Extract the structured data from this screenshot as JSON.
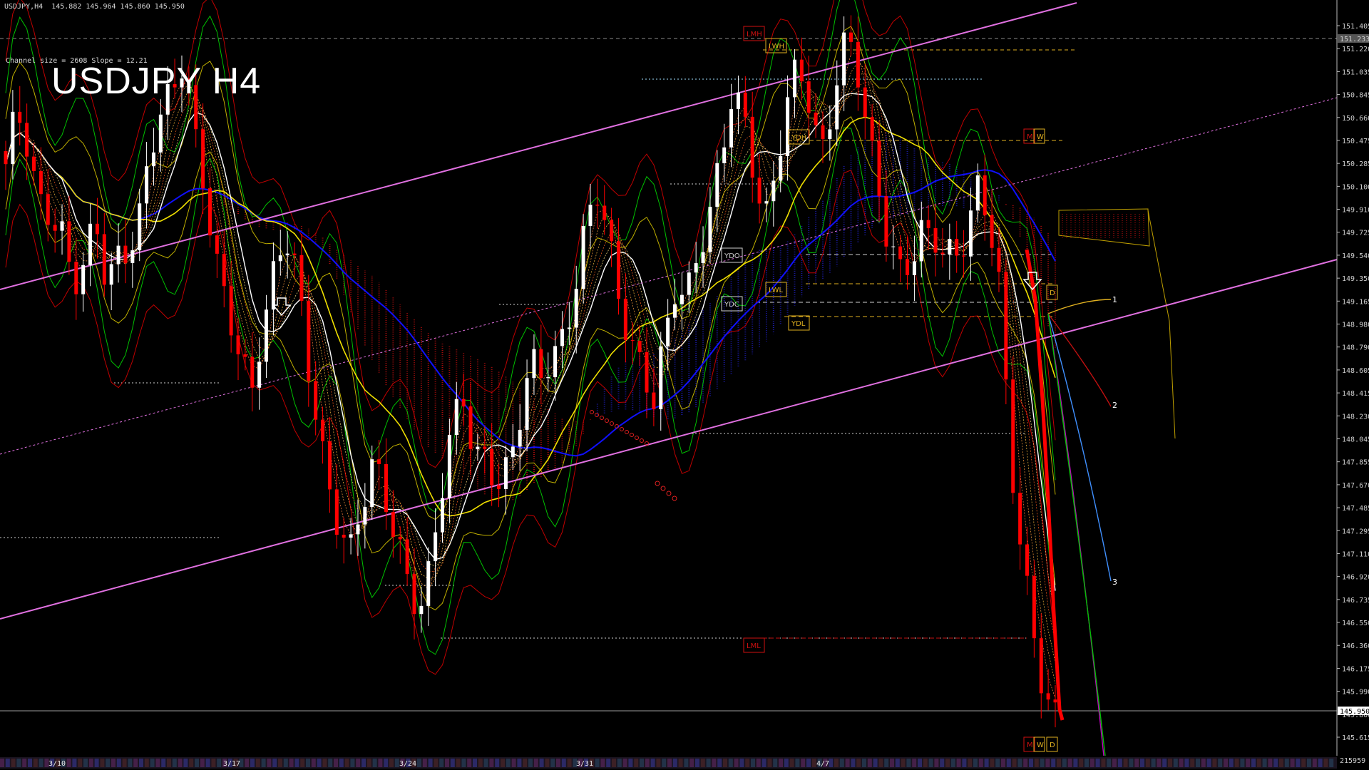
{
  "header": {
    "symbol_line": "USDJPY,H4  145.882 145.964 145.860 145.950",
    "channel_info": "Channel size = 2608 Slope = 12.21",
    "big_title": "USDJPY H4"
  },
  "price_axis": {
    "ticks": [
      "151.405",
      "151.220",
      "151.035",
      "150.845",
      "150.660",
      "150.475",
      "150.285",
      "150.100",
      "149.910",
      "149.725",
      "149.540",
      "149.350",
      "149.165",
      "148.980",
      "148.790",
      "148.605",
      "148.415",
      "148.230",
      "148.045",
      "147.855",
      "147.670",
      "147.485",
      "147.295",
      "147.110",
      "146.920",
      "146.735",
      "146.550",
      "146.360",
      "146.175",
      "145.990",
      "145.800",
      "145.615"
    ],
    "current_price": "145.950",
    "marked_price": "151.233",
    "bottom_value": "215959"
  },
  "date_axis": {
    "labels": [
      "3/10",
      "3/17",
      "3/24",
      "3/31",
      "4/7"
    ]
  },
  "level_labels": {
    "lmh": "LMH",
    "lwh": "LWH",
    "ydh": "YDH",
    "ydo": "YDO",
    "ydc": "YDC",
    "lwl": "LWL",
    "ydl": "YDL",
    "lml": "LML",
    "m": "M",
    "w": "W",
    "d": "D"
  },
  "projections": [
    "1",
    "2",
    "3"
  ],
  "colors": {
    "background": "#000000",
    "bull_candle": "#ffffff",
    "bear_candle": "#ff0000",
    "channel": "#e070e0",
    "ma_blue": "#1010ff",
    "ma_yellow": "#f0e000",
    "ma_white": "#ffffff",
    "envelope_green": "#00c000",
    "envelope_red": "#c00000",
    "cloud_red": "#c01010",
    "cloud_blue": "#2020c0"
  },
  "chart_data": {
    "type": "candlestick",
    "title": "USDJPY H4",
    "ylim": [
      145.615,
      151.405
    ],
    "x_labels": [
      "3/10",
      "3/17",
      "3/24",
      "3/31",
      "4/7"
    ],
    "last_price": 145.95,
    "ohlc_closes_approx": [
      150.1,
      150.6,
      150.4,
      149.9,
      149.7,
      149.6,
      149.3,
      149.5,
      149.7,
      149.2,
      149.45,
      149.6,
      149.8,
      150.2,
      150.6,
      150.8,
      151.1,
      150.3,
      149.8,
      149.4,
      149.1,
      148.7,
      148.3,
      148.9,
      149.4,
      149.7,
      149.3,
      148.6,
      148.2,
      147.7,
      147.3,
      147.1,
      147.6,
      148.0,
      147.6,
      147.2,
      146.9,
      146.8,
      147.1,
      147.6,
      148.1,
      148.4,
      148.0,
      147.9,
      147.6,
      147.8,
      148.3,
      148.7,
      148.5,
      148.6,
      148.9,
      149.3,
      149.7,
      149.9,
      149.6,
      149.2,
      148.8,
      148.5,
      148.3,
      148.9,
      149.3,
      149.1,
      149.4,
      149.8,
      150.3,
      150.7,
      150.5,
      150.1,
      149.8,
      150.2,
      150.6,
      150.9,
      150.7,
      150.3,
      150.6,
      151.0,
      151.1,
      150.6,
      150.1,
      149.5,
      149.3,
      149.5,
      149.7,
      149.6,
      149.4,
      149.5,
      149.7,
      150.0,
      149.7,
      149.2,
      148.0,
      147.2,
      146.5,
      146.0,
      145.95
    ],
    "channel_lines": {
      "upper": [
        [
          149.3,
          0
        ],
        [
          151.4,
          1
        ]
      ],
      "lower": [
        [
          146.6,
          0
        ],
        [
          149.5,
          1
        ]
      ]
    }
  }
}
